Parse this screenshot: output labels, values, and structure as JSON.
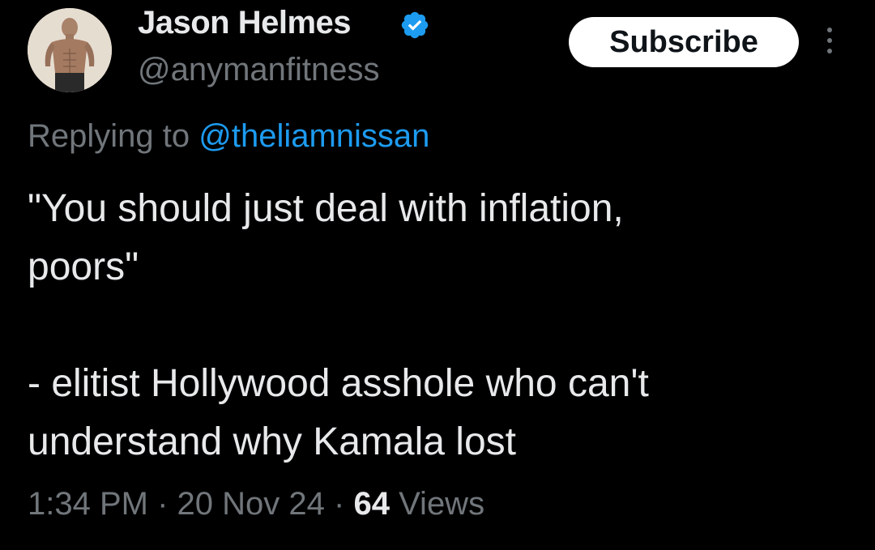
{
  "author": {
    "name": "Jason Helmes",
    "handle": "@anymanfitness"
  },
  "subscribe_label": "Subscribe",
  "reply": {
    "prefix": "Replying to",
    "target": "@theliamnissan"
  },
  "tweet": {
    "paragraph1": "\"You should just deal with inflation,\npoors\"",
    "paragraph2": "- elitist Hollywood asshole who can't\nunderstand why Kamala lost"
  },
  "meta": {
    "time": "1:34 PM",
    "separator": "·",
    "date": "20 Nov 24",
    "views_count": "64",
    "views_label": "Views"
  },
  "colors": {
    "background": "#000000",
    "text": "#e7e9ea",
    "secondary": "#71767b",
    "link": "#1d9bf0",
    "verified": "#1d9bf0"
  },
  "icons": {
    "verified": "verified-badge-icon",
    "more": "more-options-icon"
  }
}
